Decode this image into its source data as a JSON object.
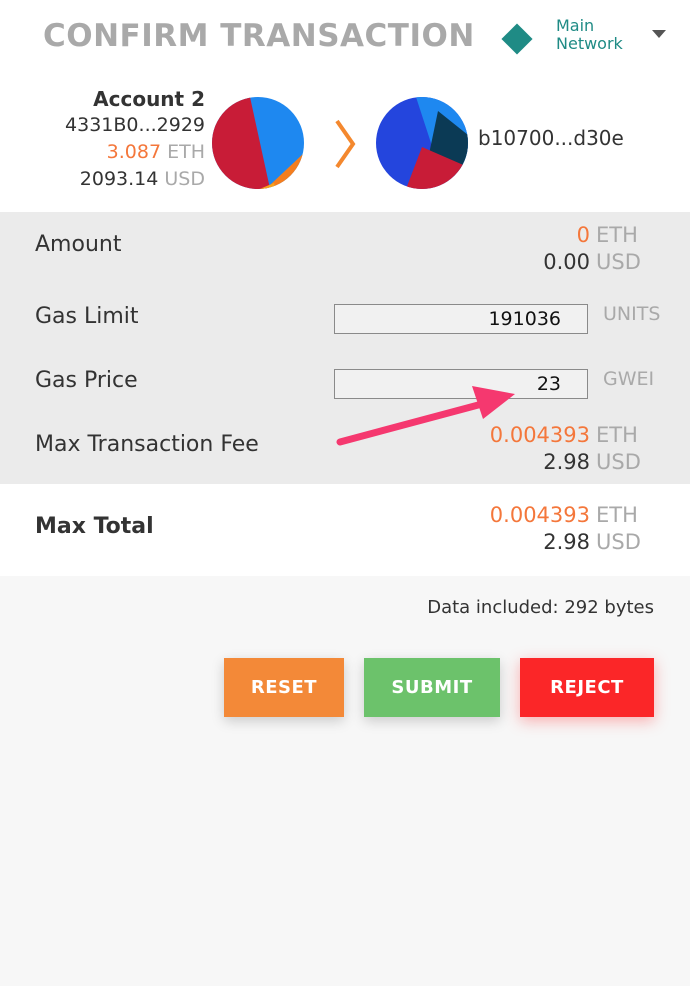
{
  "header": {
    "title": "CONFIRM TRANSACTION",
    "network": {
      "line1": "Main",
      "line2": "Network",
      "color": "#1f8b85",
      "icon": "diamond-icon",
      "caret": "caret-down-icon"
    }
  },
  "from_account": {
    "name": "Account 2",
    "address": "4331B0...2929",
    "balance_eth": "3.087",
    "eth_unit": "ETH",
    "balance_usd": "2093.14",
    "usd_unit": "USD"
  },
  "to_account": {
    "address": "b10700...d30e"
  },
  "arrow_icon": "chevron-right-icon",
  "details": {
    "amount": {
      "label": "Amount",
      "eth": "0",
      "eth_unit": "ETH",
      "usd": "0.00",
      "usd_unit": "USD"
    },
    "gas_limit": {
      "label": "Gas Limit",
      "value": "191036",
      "unit": "UNITS"
    },
    "gas_price": {
      "label": "Gas Price",
      "value": "23",
      "unit": "GWEI"
    },
    "max_fee": {
      "label": "Max Transaction Fee",
      "eth": "0.004393",
      "eth_unit": "ETH",
      "usd": "2.98",
      "usd_unit": "USD"
    }
  },
  "total": {
    "label": "Max Total",
    "eth": "0.004393",
    "eth_unit": "ETH",
    "usd": "2.98",
    "usd_unit": "USD"
  },
  "data_note": "Data included: 292 bytes",
  "buttons": {
    "reset": "RESET",
    "submit": "SUBMIT",
    "reject": "REJECT"
  },
  "colors": {
    "orange_value": "#f4773b",
    "reset": "#f38938",
    "submit": "#6cc26b",
    "reject": "#fb2628",
    "annotation_arrow": "#f5386f"
  }
}
